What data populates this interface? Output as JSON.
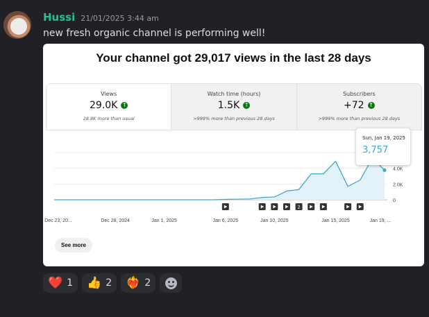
{
  "message": {
    "username": "Hussi",
    "timestamp": "21/01/2025 3:44 am",
    "text": "new fresh organic channel is performing well!",
    "username_color": "#22c28c"
  },
  "card": {
    "title": "Your channel got 29,017 views in the last 28 days",
    "stats": [
      {
        "label": "Views",
        "value": "29.0K",
        "sub": "28.8K more than usual"
      },
      {
        "label": "Watch time (hours)",
        "value": "1.5K",
        "sub": ">999% more than previous 28 days"
      },
      {
        "label": "Subscribers",
        "value": "+72",
        "sub": ">999% more than previous 28 days"
      }
    ],
    "tooltip": {
      "date": "Sun, Jan 19, 2025",
      "value": "3,757"
    },
    "see_more": "See more",
    "video_markers": [
      "",
      "",
      "",
      "",
      "2",
      "",
      "",
      "",
      ""
    ]
  },
  "chart_data": {
    "type": "area",
    "x_tick_labels": [
      "Dec 23, 20...",
      "Dec 28, 2024",
      "Jan 1, 2025",
      "Jan 6, 2025",
      "Jan 10, 2025",
      "Jan 15, 2025",
      "Jan 19, ..."
    ],
    "y_tick_labels": [
      "0",
      "2.0K",
      "4.0K"
    ],
    "ylim": [
      0,
      6000
    ],
    "x": [
      "Dec 23",
      "Dec 24",
      "Dec 25",
      "Dec 26",
      "Dec 27",
      "Dec 28",
      "Dec 29",
      "Dec 30",
      "Dec 31",
      "Jan 1",
      "Jan 2",
      "Jan 3",
      "Jan 4",
      "Jan 5",
      "Jan 6",
      "Jan 7",
      "Jan 8",
      "Jan 9",
      "Jan 10",
      "Jan 11",
      "Jan 12",
      "Jan 13",
      "Jan 14",
      "Jan 15",
      "Jan 16",
      "Jan 17",
      "Jan 18",
      "Jan 19"
    ],
    "values": [
      0,
      0,
      0,
      0,
      0,
      0,
      0,
      0,
      0,
      0,
      0,
      0,
      0,
      0,
      50,
      80,
      100,
      300,
      350,
      1100,
      1300,
      3300,
      3300,
      4900,
      1700,
      2500,
      5300,
      3757
    ],
    "line_color": "#3ea6ce",
    "fill_color": "#e3f1f8",
    "grid": true
  },
  "reactions": [
    {
      "emoji": "❤️",
      "count": "1",
      "name": "heart"
    },
    {
      "emoji": "👍",
      "count": "2",
      "name": "thumbs-up"
    },
    {
      "emoji": "❤️‍🔥",
      "count": "2",
      "name": "heart-on-fire"
    }
  ]
}
